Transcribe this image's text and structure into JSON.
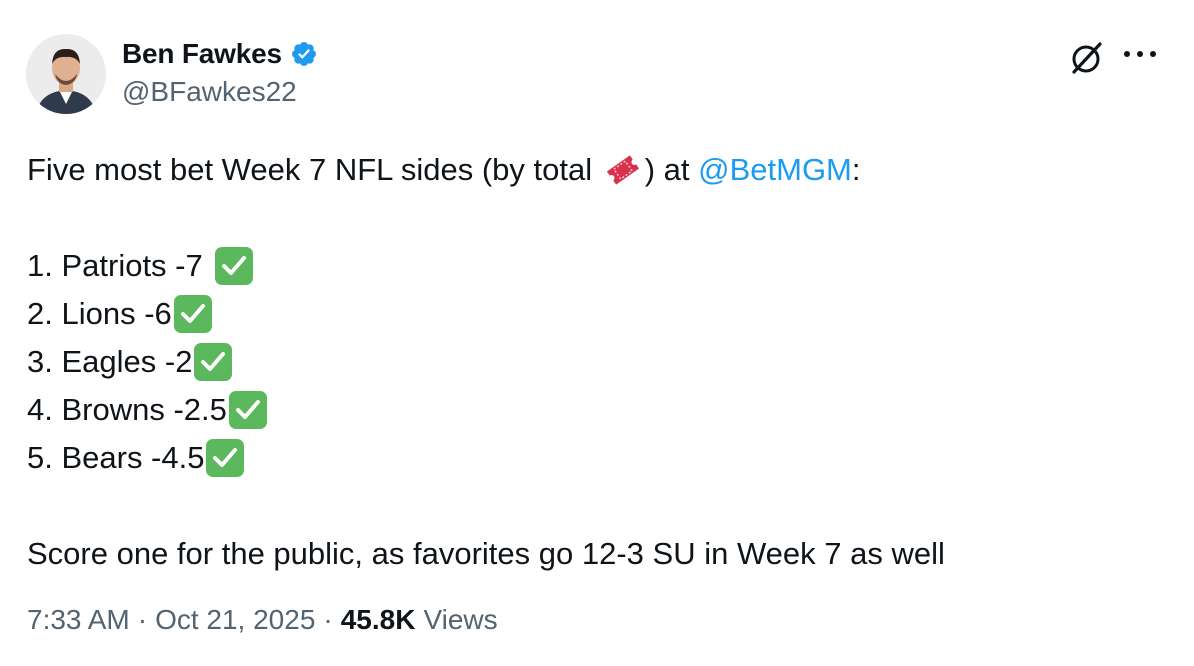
{
  "author": {
    "display_name": "Ben Fawkes",
    "handle": "@BFawkes22",
    "verified": true,
    "verified_color": "#1d9bf0"
  },
  "header_icons": {
    "grok": "grok-icon",
    "more": "more-icon"
  },
  "tweet": {
    "intro_prefix": "Five most bet Week 7 NFL sides (by total ",
    "intro_emoji": "ticket-icon",
    "intro_middle": ") at ",
    "intro_mention": "@BetMGM",
    "intro_suffix": ":",
    "items": [
      {
        "text": "1. Patriots -7",
        "spaced": true
      },
      {
        "text": "2. Lions -6",
        "spaced": false
      },
      {
        "text": "3. Eagles -2",
        "spaced": false
      },
      {
        "text": "4. Browns -2.5",
        "spaced": false
      },
      {
        "text": "5. Bears -4.5",
        "spaced": false
      }
    ],
    "check_icon": "check-mark-button-icon",
    "closing": "Score one for the public, as favorites go 12-3 SU in Week 7 as well"
  },
  "meta": {
    "time": "7:33 AM",
    "separator": "·",
    "date": "Oct 21, 2025",
    "views_count": "45.8K",
    "views_label": "Views"
  },
  "colors": {
    "text": "#0f1419",
    "secondary": "#536471",
    "mention": "#1d9bf0",
    "check_bg": "#5cb85c"
  }
}
